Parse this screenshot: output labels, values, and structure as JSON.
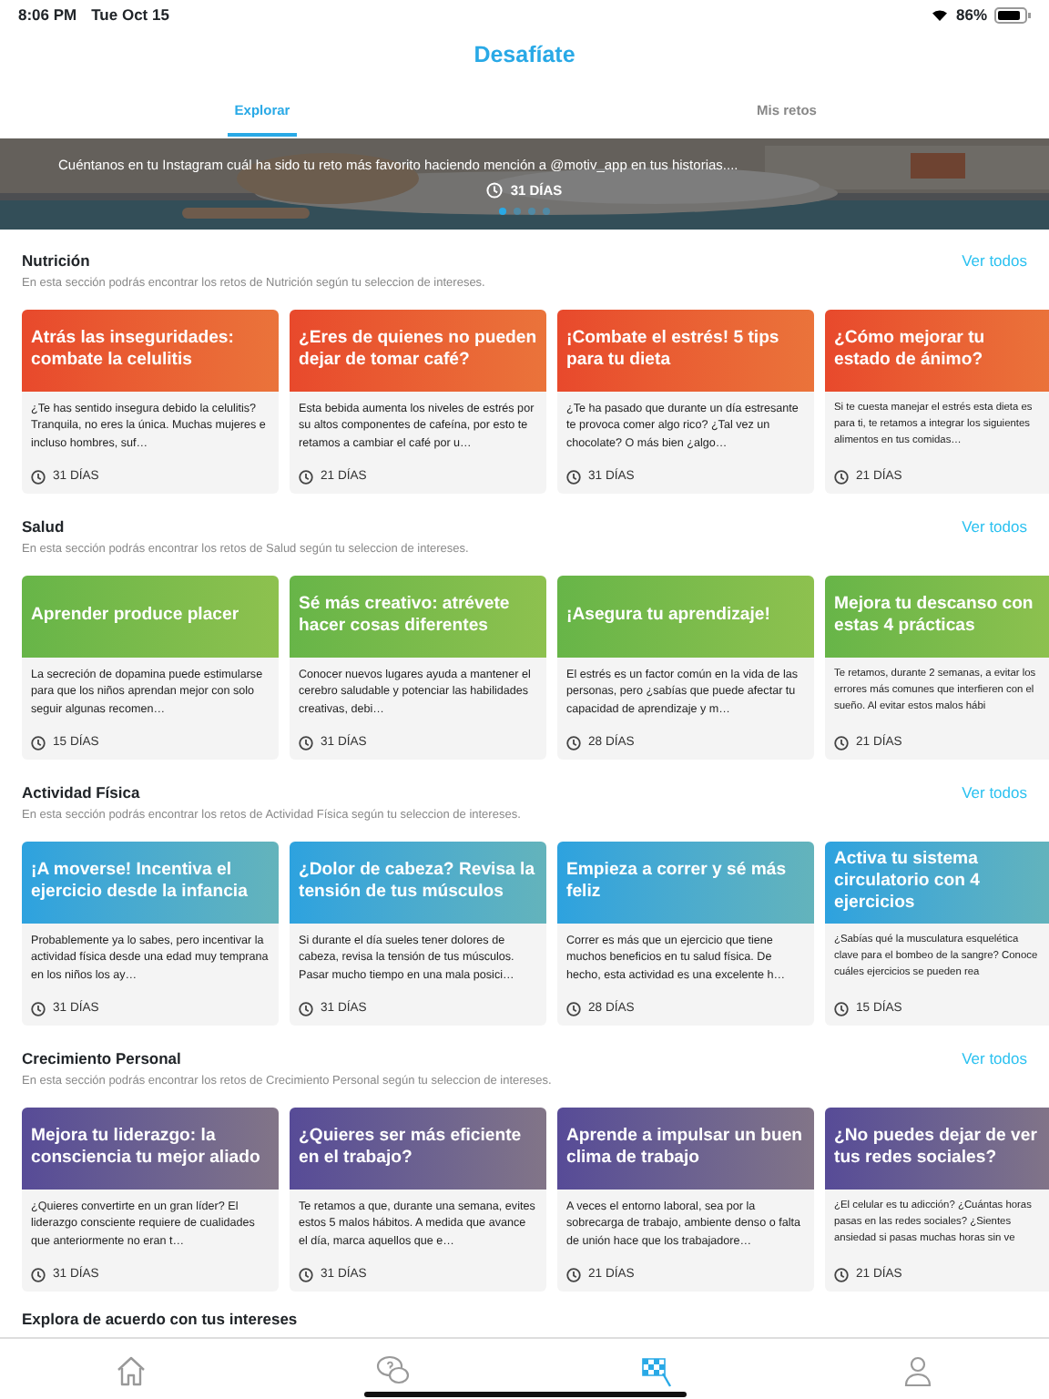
{
  "status_bar": {
    "time": "8:06 PM",
    "date": "Tue Oct 15",
    "battery": "86%"
  },
  "header": {
    "title": "Desafíate"
  },
  "tabs": [
    {
      "label": "Explorar",
      "selected": true
    },
    {
      "label": "Mis retos",
      "selected": false
    }
  ],
  "banner": {
    "kind": "picture",
    "text": "Cuéntanos en tu Instagram cuál ha sido tu reto más favorito haciendo mención a @motiv_app en tus historias....",
    "duration": "31 DÍAS",
    "dots": [
      {
        "selected": true
      },
      {
        "selected": false
      },
      {
        "selected": false
      },
      {
        "selected": false
      }
    ]
  },
  "sections": [
    {
      "title": "Nutrición",
      "link": "Ver todos",
      "description": "En esta sección podrás encontrar los retos de Nutrición según tu seleccion de intereses.",
      "color": "#e8492c",
      "cards": [
        {
          "title": "Atrás las inseguridades: combate la celulitis",
          "text": "¿Te has sentido insegura debido la celulitis? Tranquila, no eres la única. Muchas mujeres e incluso hombres, suf…",
          "duration": "31 DÍAS"
        },
        {
          "title": "¿Eres de quienes no pueden dejar de tomar café?",
          "text": "Esta bebida aumenta los niveles de estrés por su altos componentes de cafeína, por esto te retamos a cambiar el café por u…",
          "duration": "21 DÍAS"
        },
        {
          "title": "¡Combate el estrés! 5 tips para tu dieta",
          "text": "¿Te ha pasado que durante un día estresante te provoca comer algo rico? ¿Tal vez un chocolate? O más bien ¿algo…",
          "duration": "31 DÍAS"
        },
        {
          "title": "¿Cómo mejorar tu estado de ánimo?",
          "text": "Si te cuesta manejar el estrés esta dieta es para ti, te retamos a integrar los siguientes alimentos en tus comidas…",
          "duration": "21 DÍAS"
        }
      ]
    },
    {
      "title": "Salud",
      "link": "Ver todos",
      "description": "En esta sección podrás encontrar los retos de Salud según tu seleccion de intereses.",
      "color": "#67b548",
      "cards": [
        {
          "title": "Aprender produce placer",
          "text": "La secreción de dopamina puede estimularse para que los niños aprendan mejor con solo seguir algunas recomen…",
          "duration": "15 DÍAS"
        },
        {
          "title": "Sé más creativo: atrévete hacer cosas diferentes",
          "text": "Conocer nuevos lugares ayuda a mantener el cerebro saludable y potenciar las habilidades creativas, debi…",
          "duration": "31 DÍAS"
        },
        {
          "title": "¡Asegura tu aprendizaje!",
          "text": "El estrés es un factor común en la vida de las personas, pero ¿sabías que puede afectar tu capacidad de aprendizaje y m…",
          "duration": "28 DÍAS"
        },
        {
          "title": "Mejora tu descanso con estas 4 prácticas",
          "text": "Te retamos, durante 2 semanas, a evitar los errores más comunes que interfieren con el sueño. Al evitar estos malos hábi",
          "duration": "21 DÍAS"
        }
      ]
    },
    {
      "title": "Actividad Física",
      "link": "Ver todos",
      "description": "En esta sección podrás encontrar los retos de Actividad Física según tu seleccion de intereses.",
      "color": "#2da2df",
      "cards": [
        {
          "title": "¡A moverse! Incentiva el ejercicio desde la infancia",
          "text": "Probablemente ya lo sabes, pero incentivar la actividad física desde una edad muy temprana en los niños los ay…",
          "duration": "31 DÍAS"
        },
        {
          "title": "¿Dolor de cabeza? Revisa la tensión de tus músculos",
          "text": "Si durante el día sueles tener dolores de cabeza, revisa la tensión de tus músculos. Pasar mucho tiempo en una mala posici…",
          "duration": "31 DÍAS"
        },
        {
          "title": "Empieza a correr y sé más feliz",
          "text": "Correr es más que un ejercicio que tiene muchos beneficios en tu salud física. De hecho, esta actividad es una excelente h…",
          "duration": "28 DÍAS"
        },
        {
          "title": "Activa tu sistema circulatorio con 4 ejercicios",
          "text": "¿Sabías qué la musculatura esquelética clave para el bombeo de la sangre? Conoce cuáles ejercicios se pueden rea",
          "duration": "15 DÍAS"
        }
      ]
    },
    {
      "title": "Crecimiento Personal",
      "link": "Ver todos",
      "description": "En esta sección podrás encontrar los retos de Crecimiento Personal según tu seleccion de intereses.",
      "color": "#574b97",
      "cards": [
        {
          "title": "Mejora tu liderazgo: la consciencia tu mejor aliado",
          "text": "¿Quieres convertirte en un gran líder? El liderazgo consciente requiere de cualidades que anteriormente no eran t…",
          "duration": "31 DÍAS"
        },
        {
          "title": "¿Quieres ser más eficiente en el trabajo?",
          "text": "Te retamos a que, durante una semana, evites estos 5 malos hábitos. A medida que avance el día, marca aquellos que e…",
          "duration": "31 DÍAS"
        },
        {
          "title": "Aprende a impulsar un buen clima de trabajo",
          "text": "A veces el entorno laboral, sea por la sobrecarga de trabajo, ambiente denso o falta de unión hace que los trabajadore…",
          "duration": "21 DÍAS"
        },
        {
          "title": "¿No puedes dejar de ver tus redes sociales?",
          "text": "¿El celular es tu adicción? ¿Cuántas horas pasas en las redes sociales? ¿Sientes ansiedad si pasas muchas horas sin ve",
          "duration": "21 DÍAS"
        }
      ]
    }
  ],
  "footer_heading": "Explora de acuerdo con tus intereses",
  "bottom_nav": [
    {
      "kind": "home",
      "selected": false
    },
    {
      "kind": "chat",
      "selected": false
    },
    {
      "kind": "flag",
      "selected": true
    },
    {
      "kind": "profile",
      "selected": false
    }
  ]
}
